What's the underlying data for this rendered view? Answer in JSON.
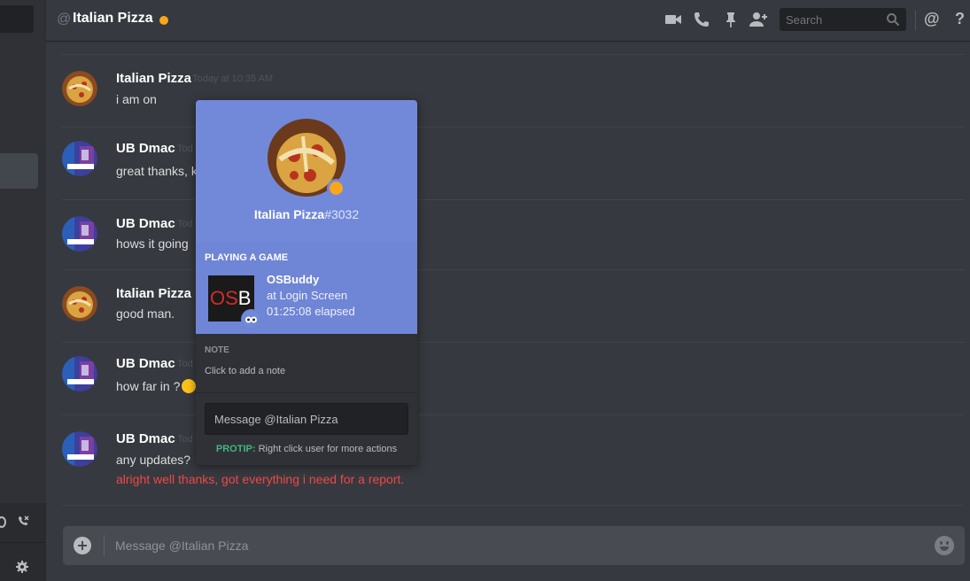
{
  "colors": {
    "accent": "#7289da",
    "idle_status": "#faa61a",
    "protip": "#43b581",
    "error_text": "#f04747"
  },
  "header": {
    "at_symbol": "@",
    "title": "Italian Pizza",
    "search_placeholder": "Search",
    "icons": [
      "video-call-icon",
      "phone-call-icon",
      "pin-icon",
      "add-friend-icon",
      "mention-icon",
      "help-icon"
    ],
    "mention_glyph": "@",
    "help_glyph": "?"
  },
  "messages": [
    {
      "author": "Italian Pizza",
      "timestamp": "Today at 10:35 AM",
      "lines": [
        "i am on"
      ]
    },
    {
      "author": "UB Dmac",
      "timestamp": "Tod",
      "lines": [
        "great thanks, k"
      ]
    },
    {
      "author": "UB Dmac",
      "timestamp": "Tod",
      "lines": [
        "hows it going"
      ]
    },
    {
      "author": "Italian Pizza",
      "timestamp": "",
      "lines": [
        "good man."
      ]
    },
    {
      "author": "UB Dmac",
      "timestamp": "Tod",
      "lines": [
        "how far in ?"
      ]
    },
    {
      "author": "UB Dmac",
      "timestamp": "Tod",
      "lines": [
        "any updates?"
      ],
      "error_line": "alright well thanks, got everything i need for a report."
    }
  ],
  "popout": {
    "username": "Italian Pizza",
    "discriminator": "#3032",
    "activity_header": "PLAYING A GAME",
    "game_icon_text_os": "OS",
    "game_icon_text_b": "B",
    "game_name": "OSBuddy",
    "game_details": "at Login Screen",
    "game_elapsed": "01:25:08 elapsed",
    "note_header": "NOTE",
    "note_placeholder": "Click to add a note",
    "message_placeholder": "Message @Italian Pizza",
    "protip_label": "PROTIP:",
    "protip_text": "Right click user for more actions"
  },
  "composer": {
    "placeholder": "Message @Italian Pizza"
  }
}
